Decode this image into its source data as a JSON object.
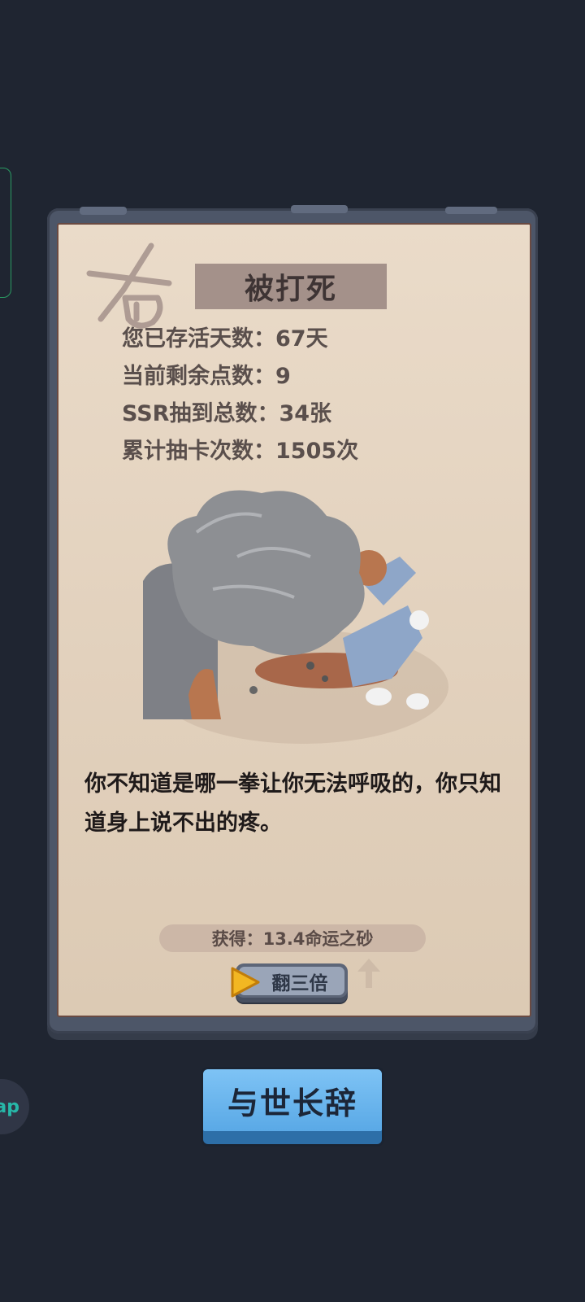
{
  "result_card": {
    "title": "被打死",
    "stats": [
      {
        "label": "您已存活天数：",
        "value": "67天"
      },
      {
        "label": "当前剩余点数：",
        "value": "9"
      },
      {
        "label": "SSR抽到总数：",
        "value": "34张"
      },
      {
        "label": "累计抽卡次数：",
        "value": "1505次"
      }
    ],
    "story": "你不知道是哪一拳让你无法呼吸的，你只知道身上说不出的疼。",
    "reward": "获得：13.4命运之砂",
    "triple_button": "翻三倍"
  },
  "confirm_button": "与世长辞",
  "floating_bubble": "ap",
  "colors": {
    "background": "#1f2531",
    "paper": "#e4d4c1",
    "stone_frame": "#4d5668",
    "confirm_button": "#5aa9e6",
    "title_banner": "#a4918a"
  },
  "icons": [
    "dead-stamp-icon",
    "play-triangle-icon",
    "up-arrow-icon"
  ]
}
